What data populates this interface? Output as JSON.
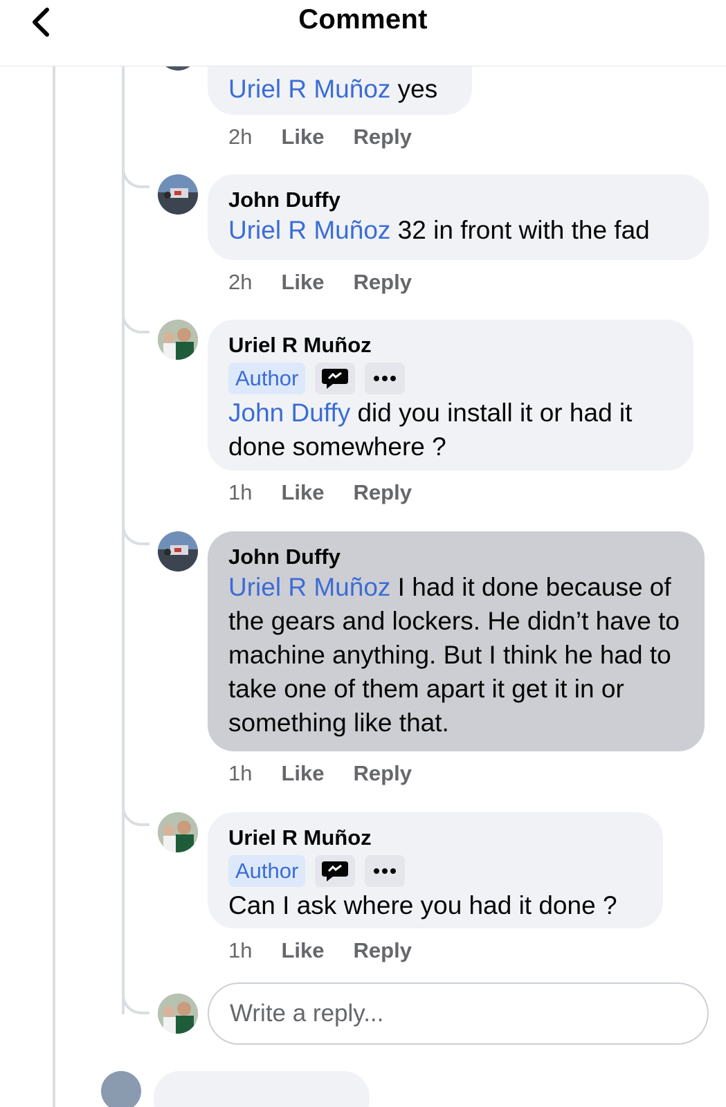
{
  "header": {
    "title": "Comment"
  },
  "comments": [
    {
      "mention": "Uriel R Muñoz",
      "text": " yes",
      "time": "2h",
      "like": "Like",
      "reply": "Reply"
    },
    {
      "author": "John Duffy",
      "mention": "Uriel R Muñoz",
      "text": " 32 in front with the fad",
      "time": "2h",
      "like": "Like",
      "reply": "Reply"
    },
    {
      "author": "Uriel R Muñoz",
      "badge": "Author",
      "mention": "John Duffy",
      "text": " did you install it or had it done somewhere ?",
      "time": "1h",
      "like": "Like",
      "reply": "Reply"
    },
    {
      "author": "John Duffy",
      "mention": "Uriel R Muñoz",
      "text": " I had it done because of the gears and lockers. He didn’t have to machine anything. But I think he had to take one of them apart it get it in or something like that.",
      "time": "1h",
      "like": "Like",
      "reply": "Reply"
    },
    {
      "author": "Uriel R Muñoz",
      "badge": "Author",
      "text": "Can I ask where you had it done ?",
      "time": "1h",
      "like": "Like",
      "reply": "Reply"
    }
  ],
  "reply_box": {
    "placeholder": "Write a reply..."
  },
  "icons": {
    "back": "chevron-left-icon",
    "badge_chat": "chat-bubble-icon",
    "badge_more": "more-dots-icon"
  },
  "colors": {
    "mention": "#3b6cd6",
    "bubble": "#f0f2f5",
    "highlight_bubble": "#cdced3",
    "author_badge_bg": "#dde9fb"
  }
}
